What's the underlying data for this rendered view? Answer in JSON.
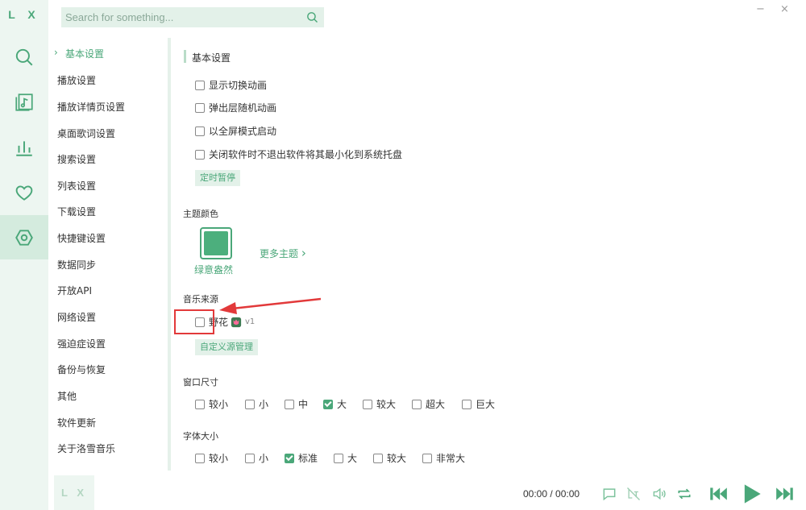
{
  "app": {
    "logo": "L X",
    "mini_logo": "L X"
  },
  "search": {
    "placeholder": "Search for something..."
  },
  "window": {
    "minimize": "−",
    "close": "×"
  },
  "rail": [
    "search-icon",
    "music-list-icon",
    "chart-icon",
    "heart-icon",
    "settings-icon"
  ],
  "nav": {
    "items": [
      {
        "label": "基本设置",
        "active": true
      },
      {
        "label": "播放设置"
      },
      {
        "label": "播放详情页设置"
      },
      {
        "label": "桌面歌词设置"
      },
      {
        "label": "搜索设置"
      },
      {
        "label": "列表设置"
      },
      {
        "label": "下载设置"
      },
      {
        "label": "快捷键设置"
      },
      {
        "label": "数据同步"
      },
      {
        "label": "开放API"
      },
      {
        "label": "网络设置"
      },
      {
        "label": "强迫症设置"
      },
      {
        "label": "备份与恢复"
      },
      {
        "label": "其他"
      },
      {
        "label": "软件更新"
      },
      {
        "label": "关于洛雪音乐"
      }
    ]
  },
  "basic": {
    "title": "基本设置",
    "options": [
      {
        "label": "显示切换动画",
        "checked": false
      },
      {
        "label": "弹出层随机动画",
        "checked": false
      },
      {
        "label": "以全屏模式启动",
        "checked": false
      },
      {
        "label": "关闭软件时不退出软件将其最小化到系统托盘",
        "checked": false
      }
    ],
    "timer_button": "定时暂停"
  },
  "theme": {
    "heading": "主题颜色",
    "current_name": "绿意盎然",
    "current_color": "#4caf7d",
    "more_label": "更多主题"
  },
  "source": {
    "heading": "音乐来源",
    "item_label": "野花",
    "item_version": "v1",
    "item_checked": false,
    "manage_button": "自定义源管理"
  },
  "window_size": {
    "heading": "窗口尺寸",
    "options": [
      {
        "label": "较小",
        "checked": false
      },
      {
        "label": "小",
        "checked": false
      },
      {
        "label": "中",
        "checked": false
      },
      {
        "label": "大",
        "checked": true
      },
      {
        "label": "较大",
        "checked": false
      },
      {
        "label": "超大",
        "checked": false
      },
      {
        "label": "巨大",
        "checked": false
      }
    ]
  },
  "font_size": {
    "heading": "字体大小",
    "options": [
      {
        "label": "较小",
        "checked": false
      },
      {
        "label": "小",
        "checked": false
      },
      {
        "label": "标准",
        "checked": true
      },
      {
        "label": "大",
        "checked": false
      },
      {
        "label": "较大",
        "checked": false
      },
      {
        "label": "非常大",
        "checked": false
      }
    ]
  },
  "player": {
    "time": "00:00 / 00:00",
    "controls": [
      "comment-icon",
      "lyric-off-icon",
      "volume-icon",
      "loop-icon",
      "prev-icon",
      "play-icon",
      "next-icon"
    ]
  },
  "colors": {
    "accent": "#4aa779",
    "annotation": "#e2393a"
  }
}
